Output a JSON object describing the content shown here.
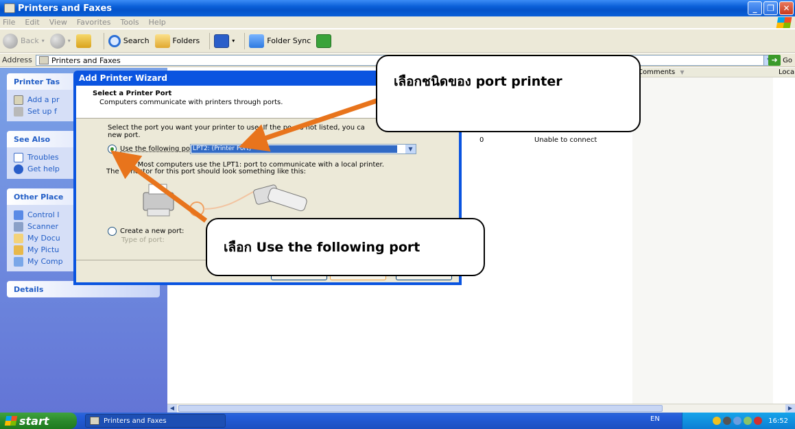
{
  "window": {
    "title": "Printers and Faxes",
    "min": "_",
    "max": "❐",
    "close": "✕"
  },
  "menu": [
    "File",
    "Edit",
    "View",
    "Favorites",
    "Tools",
    "Help"
  ],
  "toolbar": {
    "back": "Back",
    "search": "Search",
    "folders": "Folders",
    "folder_sync": "Folder Sync"
  },
  "address": {
    "label": "Address",
    "value": "Printers and Faxes",
    "go": "Go"
  },
  "tasks": {
    "printer_tasks": {
      "title": "Printer Tas",
      "items": [
        "Add a pr",
        "Set up f"
      ]
    },
    "see_also": {
      "title": "See Also",
      "items": [
        "Troubles",
        "Get help"
      ]
    },
    "other_places": {
      "title": "Other Place",
      "items": [
        "Control I",
        "Scanner",
        "My Docu",
        "My Pictu",
        "My Comp"
      ]
    },
    "details": {
      "title": "Details"
    }
  },
  "list": {
    "columns": [
      "Comments",
      "Loca"
    ],
    "row": {
      "count": "0",
      "status": "Unable to connect"
    }
  },
  "wizard": {
    "title": "Add Printer Wizard",
    "heading": "Select a Printer Port",
    "subheading": "Computers communicate with printers through ports.",
    "instruction_1": "Select the port you want your printer to use.  If the po",
    "instruction_1b": "s not listed, you ca",
    "instruction_2": "new port.",
    "use_port_label": "Use the following port:",
    "port_value": "LPT2: (Printer Port)",
    "note_1": "No",
    "note_1b": "Most computers use the LPT1: port to communicate with a local printer.",
    "note_2": "The c",
    "note_2b": "nector for this port should look something like this:",
    "create_port_label": "Create a new port:",
    "type_of_port_label": "Type of port:"
  },
  "callouts": {
    "top": "เลือกชนิดของ port printer",
    "bottom": "เลือก   Use the following port"
  },
  "taskbar": {
    "start": "start",
    "item": "Printers and Faxes",
    "lang": "EN",
    "clock": "16:52"
  },
  "colors": {
    "title_blue": "#0a5fd8",
    "task_pane": "#6f8fe0",
    "callout_arrow": "#e8741c",
    "start_green": "#2c8a2c"
  }
}
